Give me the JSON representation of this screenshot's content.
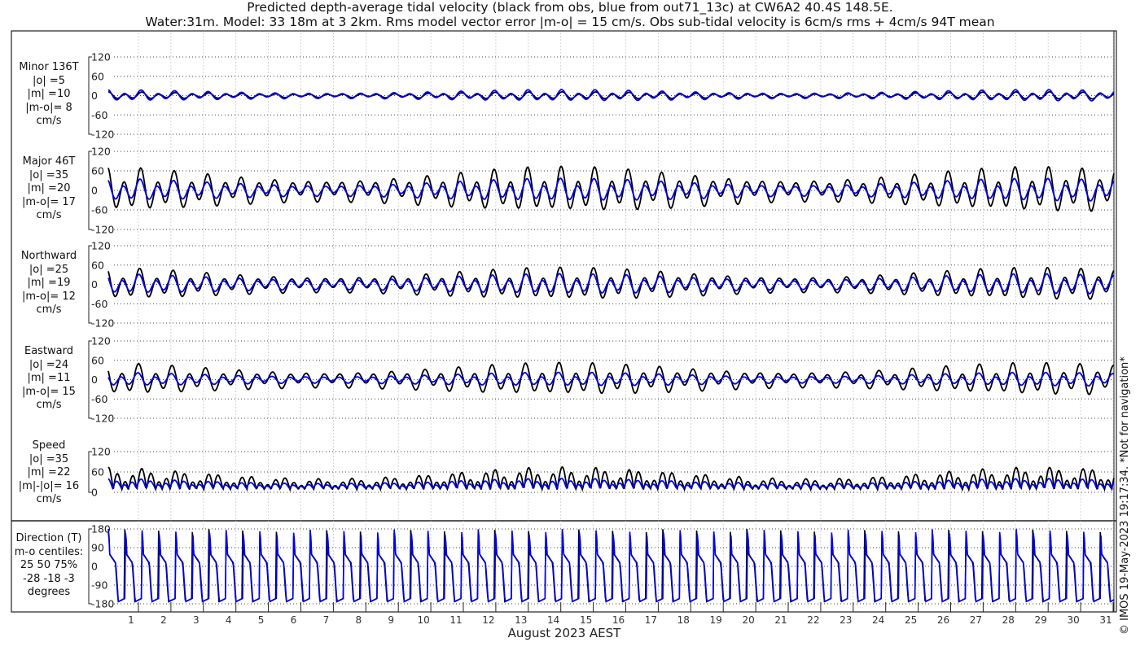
{
  "header": {
    "title1": "Predicted depth-average tidal velocity (black from obs, blue from out71_13c) at CW6A2 40.4S 148.5E.",
    "title2": "Water:31m. Model: 33 18m at 3 2km. Rms model vector error |m-o| = 15 cm/s. Obs sub-tidal velocity is 6cm/s rms + 4cm/s 94T mean"
  },
  "credit": "© IMOS 19-May-2023 19:17:34. *Not for navigation*",
  "chart_data": {
    "type": "line",
    "xlabel": "August 2023 AEST",
    "x_ticks": [
      "1",
      "2",
      "3",
      "4",
      "5",
      "6",
      "7",
      "8",
      "9",
      "10",
      "11",
      "12",
      "13",
      "14",
      "15",
      "16",
      "17",
      "18",
      "19",
      "20",
      "21",
      "22",
      "23",
      "24",
      "25",
      "26",
      "27",
      "28",
      "29",
      "30",
      "31"
    ],
    "colors": {
      "obs": "#000000",
      "model": "#0000ee"
    },
    "legend": "in title",
    "panels": [
      {
        "label": [
          "Minor 136T",
          "|o| =5",
          "|m| =10",
          "|m-o|= 8",
          "cm/s"
        ],
        "ylim": [
          -120,
          120
        ],
        "yticks": [
          "120",
          "60",
          "0",
          "-60",
          "-120"
        ],
        "obs_amp": 8,
        "model_amp": 14
      },
      {
        "label": [
          "Major 46T",
          "|o| =35",
          "|m| =20",
          "|m-o|= 17",
          "cm/s"
        ],
        "ylim": [
          -120,
          120
        ],
        "yticks": [
          "120",
          "60",
          "0",
          "-60",
          "-120"
        ],
        "obs_amp": 50,
        "model_amp": 28
      },
      {
        "label": [
          "Northward",
          "|o| =25",
          "|m| =19",
          "|m-o|= 12",
          "cm/s"
        ],
        "ylim": [
          -120,
          120
        ],
        "yticks": [
          "120",
          "60",
          "0",
          "-60",
          "-120"
        ],
        "obs_amp": 36,
        "model_amp": 25
      },
      {
        "label": [
          "Eastward",
          "|o| =24",
          "|m| =11",
          "|m-o|= 15",
          "cm/s"
        ],
        "ylim": [
          -120,
          120
        ],
        "yticks": [
          "120",
          "60",
          "0",
          "-60",
          "-120"
        ],
        "obs_amp": 36,
        "model_amp": 17
      },
      {
        "label": [
          "Speed",
          "|o| =35",
          "|m| =22",
          "|m|-|o|= 16",
          "cm/s"
        ],
        "ylim": [
          0,
          120
        ],
        "yticks": [
          "120",
          "60",
          "0"
        ],
        "obs_amp": 50,
        "model_amp": 28
      },
      {
        "label": [
          "Direction (T)",
          "m-o centiles:",
          "25  50  75%",
          "-28 -18  -3",
          "degrees"
        ],
        "ylim": [
          -180,
          180
        ],
        "yticks": [
          "180",
          "90",
          "0",
          "-90",
          "-180"
        ]
      }
    ]
  }
}
